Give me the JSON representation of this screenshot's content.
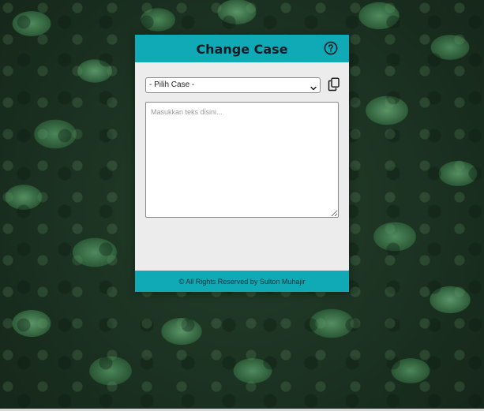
{
  "app": {
    "title": "Change Case"
  },
  "header": {
    "title": "Change Case",
    "help_icon": "question-circle-icon"
  },
  "controls": {
    "case_select": {
      "selected": "- Pilih Case -",
      "options": [
        "- Pilih Case -"
      ]
    },
    "copy_icon": "copy-icon"
  },
  "editor": {
    "placeholder": "Masukkan teks disini...",
    "value": ""
  },
  "footer": {
    "text": "© All Rights Reserved by Sulton Muhajir"
  },
  "colors": {
    "accent": "#10aab7",
    "card_background": "#ececec",
    "title_text": "#0d1b24"
  }
}
